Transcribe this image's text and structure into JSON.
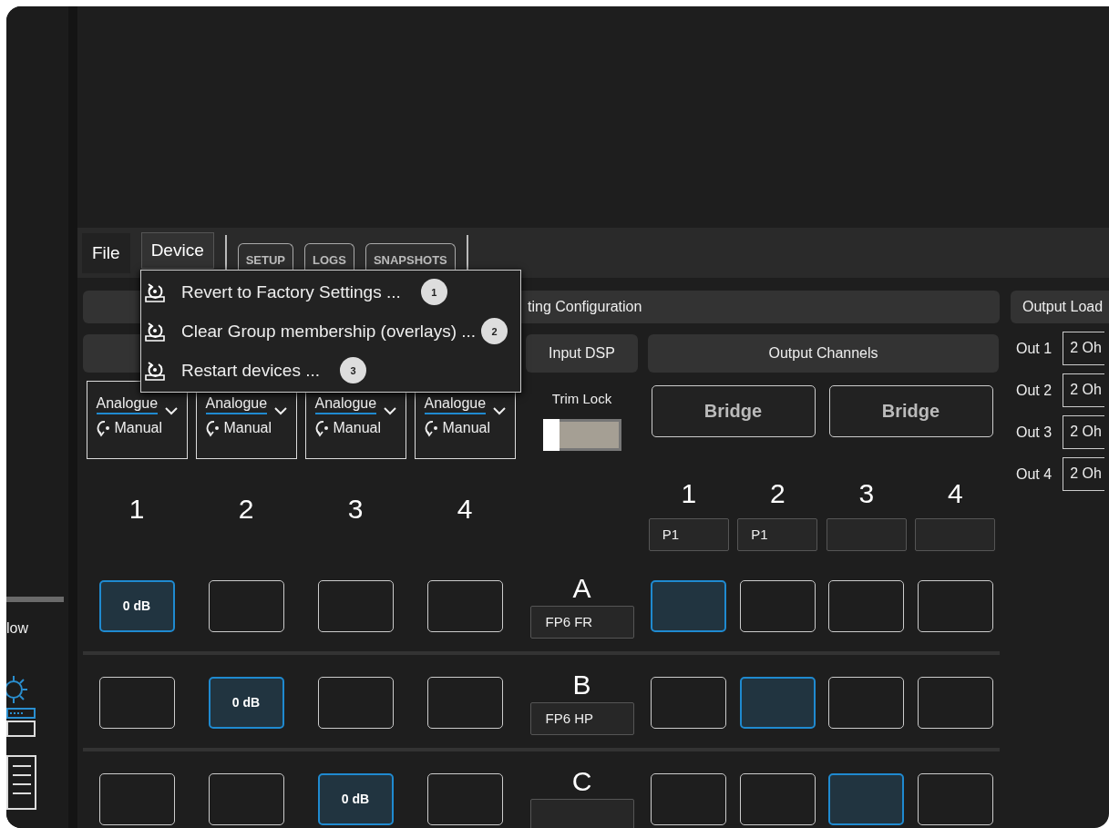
{
  "sidebar": {
    "label": "low"
  },
  "menubar": [
    {
      "label": "File",
      "selected": false
    },
    {
      "label": "Device",
      "selected": true
    }
  ],
  "tabs": [
    {
      "label": "SETUP"
    },
    {
      "label": "LOGS"
    },
    {
      "label": "SNAPSHOTS"
    }
  ],
  "device_menu": [
    {
      "label": "Revert to Factory Settings ...",
      "badge": "1"
    },
    {
      "label": "Clear Group membership (overlays) ...",
      "badge": "2"
    },
    {
      "label": "Restart devices ...",
      "badge": "3"
    }
  ],
  "routing": {
    "title": "ting Configuration",
    "input_dsp": "Input DSP",
    "output_channels": "Output Channels"
  },
  "inputs": [
    {
      "source": "Analogue",
      "mode": "Manual",
      "number": "1"
    },
    {
      "source": "Analogue",
      "mode": "Manual",
      "number": "2"
    },
    {
      "source": "Analogue",
      "mode": "Manual",
      "number": "3"
    },
    {
      "source": "Analogue",
      "mode": "Manual",
      "number": "4"
    }
  ],
  "trim_lock": {
    "label": "Trim Lock",
    "on": false
  },
  "bridges": [
    "Bridge",
    "Bridge"
  ],
  "outputs": [
    {
      "number": "1",
      "name": "P1"
    },
    {
      "number": "2",
      "name": "P1"
    },
    {
      "number": "3"
    },
    {
      "number": "4"
    }
  ],
  "matrix": [
    {
      "letter": "A",
      "name": "FP6 FR",
      "inputs": [
        {
          "selected": true,
          "value": "0 dB"
        },
        {
          "selected": false
        },
        {
          "selected": false
        },
        {
          "selected": false
        }
      ],
      "outputs": [
        {
          "selected": true
        },
        {
          "selected": false
        },
        {
          "selected": false
        },
        {
          "selected": false
        }
      ]
    },
    {
      "letter": "B",
      "name": "FP6 HP",
      "inputs": [
        {
          "selected": false
        },
        {
          "selected": true,
          "value": "0 dB"
        },
        {
          "selected": false
        },
        {
          "selected": false
        }
      ],
      "outputs": [
        {
          "selected": false
        },
        {
          "selected": true
        },
        {
          "selected": false
        },
        {
          "selected": false
        }
      ]
    },
    {
      "letter": "C",
      "inputs": [
        {
          "selected": false
        },
        {
          "selected": false
        },
        {
          "selected": true,
          "value": "0 dB"
        },
        {
          "selected": false
        }
      ],
      "outputs": [
        {
          "selected": false
        },
        {
          "selected": false
        },
        {
          "selected": true
        },
        {
          "selected": false
        }
      ]
    }
  ],
  "output_load": {
    "title": "Output Load",
    "rows": [
      {
        "label": "Out 1",
        "value": "2 Oh"
      },
      {
        "label": "Out 2",
        "value": "2 Oh"
      },
      {
        "label": "Out 3",
        "value": "2 Oh"
      },
      {
        "label": "Out 4",
        "value": "2 Oh"
      }
    ]
  }
}
